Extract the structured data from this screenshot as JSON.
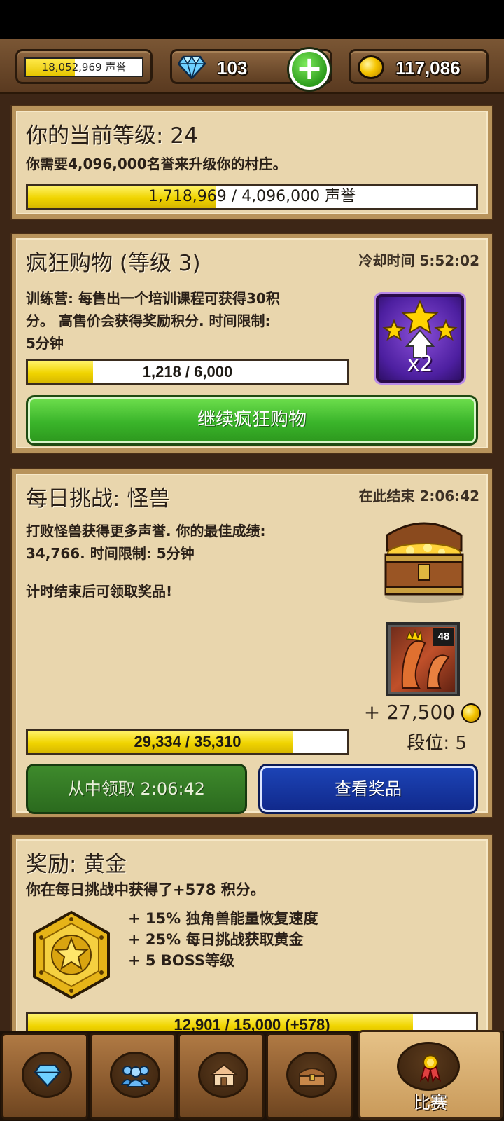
{
  "colors": {
    "accent_yellow": "#f0d400",
    "panel_bg": "#e9d6ad",
    "wood": "#5a3a20",
    "green": "#3ab42a",
    "blue": "#10288a"
  },
  "top_bar": {
    "fame_text": "18,052,969 声誉",
    "fame_progress": 0.42,
    "gems": "103",
    "gold": "117,086",
    "add_icon": "plus-icon",
    "gem_icon": "diamond-icon",
    "gold_icon": "coin-icon"
  },
  "level_panel": {
    "title": "你的当前等级: 24",
    "description": "你需要4,096,000名誉来升级你的村庄。",
    "progress_text": "1,718,969 / 4,096,000 声誉",
    "progress": 0.42
  },
  "shopping_panel": {
    "title": "疯狂购物 (等级 3)",
    "cooldown": "冷却时间 5:52:02",
    "description_line1": "训练营: 每售出一个培训课程可获得30积",
    "description_line2": "分。 高售价会获得奖励积分. 时间限制:",
    "description_line3": "5分钟",
    "progress_text": "1,218 / 6,000",
    "progress": 0.203,
    "boost_label": "x2",
    "button_label": "继续疯狂购物"
  },
  "challenge_panel": {
    "title": "每日挑战: 怪兽",
    "ends_at": "在此结束 2:06:42",
    "description_line1": "打败怪兽获得更多声誉. 你的最佳成绩:",
    "description_line2": "34,766. 时间限制: 5分钟",
    "note": "计时结束后可领取奖品!",
    "monster_level": "48",
    "reward_amount": "+ 27,500",
    "rank": "段位: 5",
    "progress_text": "29,334 / 35,310",
    "progress": 0.831,
    "claim_button": "从中领取 2:06:42",
    "view_prize_button": "查看奖品"
  },
  "reward_panel": {
    "title": "奖励: 黄金",
    "description": "你在每日挑战中获得了+578 积分。",
    "bonuses": [
      "+ 15% 独角兽能量恢复速度",
      "+ 25% 每日挑战获取黄金",
      "+ 5 BOSS等级"
    ],
    "progress_text": "12,901 / 15,000 (+578)",
    "progress": 0.86
  },
  "bottom_nav": {
    "tabs": [
      {
        "icon": "diamond-icon"
      },
      {
        "icon": "people-icon"
      },
      {
        "icon": "village-icon"
      },
      {
        "icon": "chest-icon"
      },
      {
        "icon": "medal-icon",
        "label": "比赛"
      }
    ]
  }
}
